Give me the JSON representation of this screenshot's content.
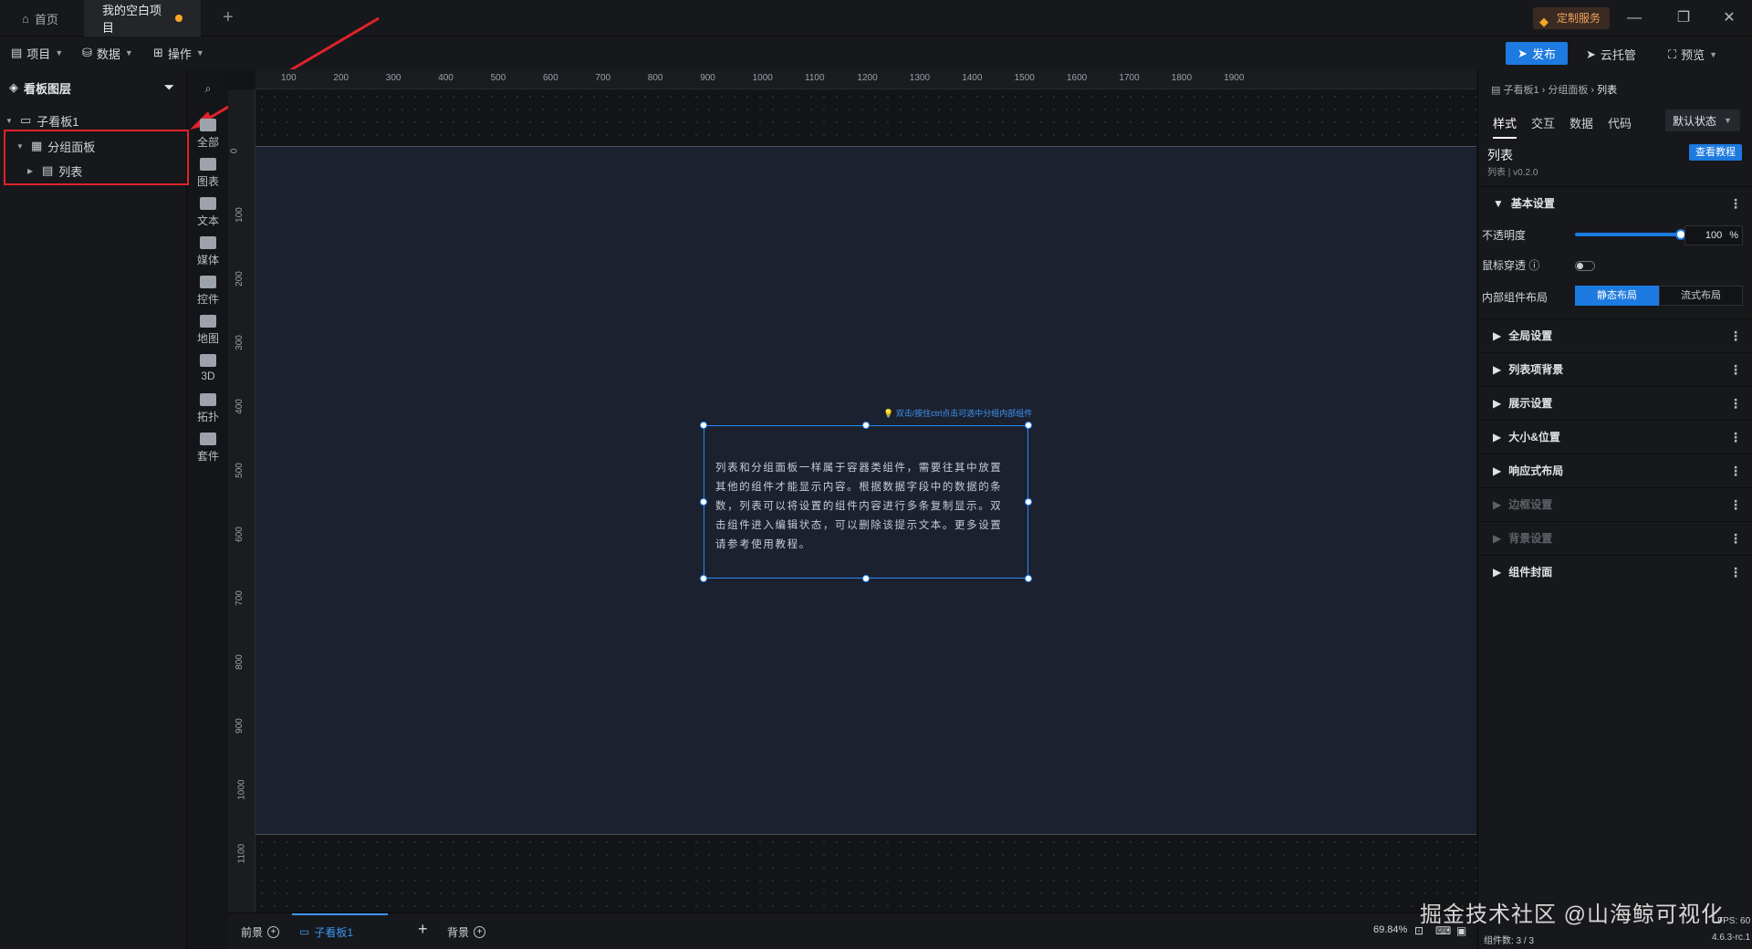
{
  "titlebar": {
    "home_tab": "首页",
    "project_tab": "我的空白项目",
    "custom_service": "定制服务"
  },
  "menubar": {
    "project": "项目",
    "data": "数据",
    "operate": "操作",
    "publish": "发布",
    "cloud_host": "云托管",
    "preview": "预览"
  },
  "layers": {
    "title": "看板图层",
    "tree": [
      {
        "label": "子看板1"
      },
      {
        "label": "分组面板"
      },
      {
        "label": "列表"
      }
    ]
  },
  "iconbar": [
    {
      "label": "全部",
      "icon": "grid-icon"
    },
    {
      "label": "图表",
      "icon": "bar-chart-icon"
    },
    {
      "label": "文本",
      "icon": "text-icon"
    },
    {
      "label": "媒体",
      "icon": "media-icon"
    },
    {
      "label": "控件",
      "icon": "widget-icon"
    },
    {
      "label": "地图",
      "icon": "map-icon"
    },
    {
      "label": "3D",
      "icon": "cube-icon"
    },
    {
      "label": "拓扑",
      "icon": "topology-icon"
    },
    {
      "label": "套件",
      "icon": "kit-icon"
    }
  ],
  "ruler": {
    "h_labels": [
      "100",
      "200",
      "300",
      "400",
      "500",
      "600",
      "700",
      "800",
      "900",
      "1000",
      "1100",
      "1200",
      "1300",
      "1400",
      "1500",
      "1600",
      "1700",
      "1800",
      "1900"
    ],
    "v_labels": [
      "0",
      "100",
      "200",
      "300",
      "400",
      "500",
      "600",
      "700",
      "800",
      "900",
      "1000",
      "1100"
    ]
  },
  "canvas": {
    "hint": "双击/按住ctrl点击可选中分组内部组件",
    "text": "列表和分组面板一样属于容器类组件，需要往其中放置其他的组件才能显示内容。根据数据字段中的数据的条数，列表可以将设置的组件内容进行多条复制显示。双击组件进入编辑状态，可以删除该提示文本。更多设置请参考使用教程。"
  },
  "bottombar": {
    "front": "前景",
    "board": "子看板1",
    "background": "背景",
    "zoom": "69.84%",
    "component_count": "组件数: 3 / 3",
    "version": "4.6.3-rc.1",
    "fps": "FPS: 60"
  },
  "rightpanel": {
    "breadcrumb": [
      "子看板1",
      "分组面板",
      "列表"
    ],
    "tabs": [
      "样式",
      "交互",
      "数据",
      "代码"
    ],
    "state": "默认状态",
    "component_name": "列表",
    "component_version": "列表 | v0.2.0",
    "tutorial": "查看教程",
    "basic": "基本设置",
    "opacity_label": "不透明度",
    "opacity_value": "100",
    "opacity_unit": "%",
    "opacity_level": 1.0,
    "mouse_through": "鼠标穿透",
    "layout_label": "内部组件布局",
    "layout_static": "静态布局",
    "layout_flow": "流式布局",
    "sections": [
      {
        "label": "全局设置",
        "dim": false
      },
      {
        "label": "列表项背景",
        "dim": false
      },
      {
        "label": "展示设置",
        "dim": false
      },
      {
        "label": "大小&位置",
        "dim": false
      },
      {
        "label": "响应式布局",
        "dim": false
      },
      {
        "label": "边框设置",
        "dim": true
      },
      {
        "label": "背景设置",
        "dim": true
      },
      {
        "label": "组件封面",
        "dim": false
      }
    ]
  },
  "watermark": "掘金技术社区 @山海鲸可视化",
  "colors": {
    "accent": "#1d7ae0",
    "highlight": "#e0232b",
    "selection": "#2b8bf2"
  }
}
